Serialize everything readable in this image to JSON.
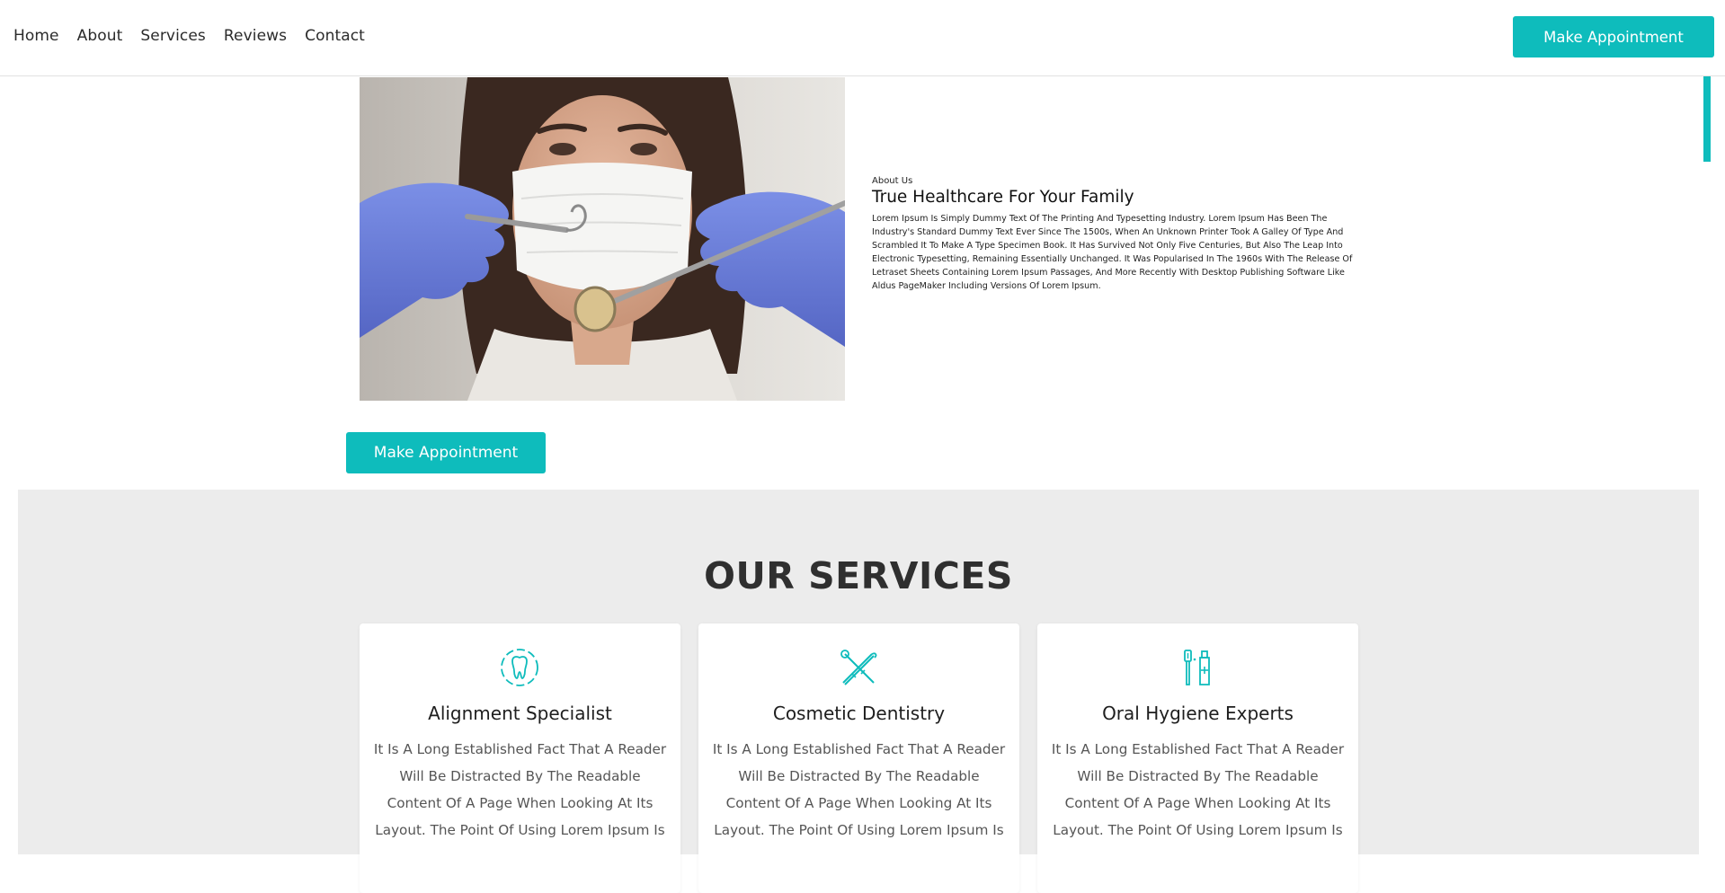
{
  "nav": {
    "links": [
      "Home",
      "About",
      "Services",
      "Reviews",
      "Contact"
    ],
    "cta_label": "Make Appointment"
  },
  "about": {
    "kicker": "About Us",
    "heading": "True Healthcare For Your Family",
    "body": "Lorem Ipsum Is Simply Dummy Text Of The Printing And Typesetting Industry. Lorem Ipsum Has Been The Industry's Standard Dummy Text Ever Since The 1500s, When An Unknown Printer Took A Galley Of Type And Scrambled It To Make A Type Specimen Book. It Has Survived Not Only Five Centuries, But Also The Leap Into Electronic Typesetting, Remaining Essentially Unchanged. It Was Popularised In The 1960s With The Release Of Letraset Sheets Containing Lorem Ipsum Passages, And More Recently With Desktop Publishing Software Like Aldus PageMaker Including Versions Of Lorem Ipsum.",
    "cta_label": "Make Appointment",
    "photo_icon": "dentist-photo"
  },
  "services": {
    "title": "OUR SERVICES",
    "cards": [
      {
        "icon": "tooth-icon",
        "title": "Alignment Specialist",
        "text": "It Is A Long Established Fact That A Reader Will Be Distracted By The Readable Content Of A Page When Looking At Its Layout. The Point Of Using Lorem Ipsum Is"
      },
      {
        "icon": "dental-tools-icon",
        "title": "Cosmetic Dentistry",
        "text": "It Is A Long Established Fact That A Reader Will Be Distracted By The Readable Content Of A Page When Looking At Its Layout. The Point Of Using Lorem Ipsum Is"
      },
      {
        "icon": "toothbrush-paste-icon",
        "title": "Oral Hygiene Experts",
        "text": "It Is A Long Established Fact That A Reader Will Be Distracted By The Readable Content Of A Page When Looking At Its Layout. The Point Of Using Lorem Ipsum Is"
      }
    ]
  },
  "colors": {
    "accent": "#0ebcbc",
    "services_bg": "#ececec",
    "glove": "#6b7fd9",
    "text": "#2b2b2b"
  }
}
